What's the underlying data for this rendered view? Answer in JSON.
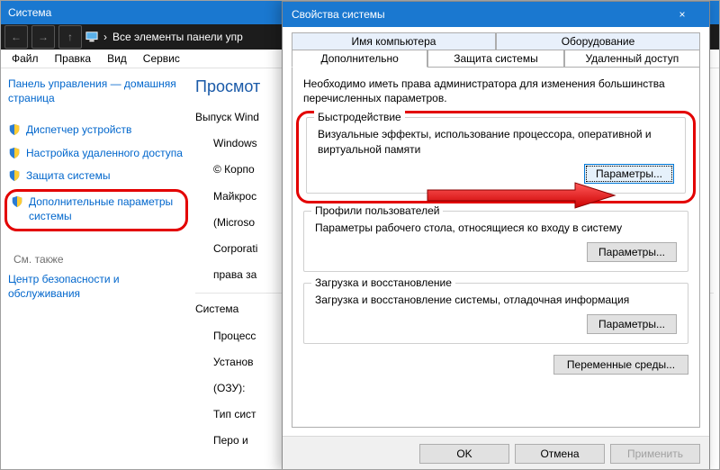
{
  "sysWindow": {
    "title": "Система",
    "breadcrumb": "Все элементы панели упр",
    "menubar": [
      "Файл",
      "Правка",
      "Вид",
      "Сервис"
    ],
    "winbtns": {
      "min": "–",
      "max": "□",
      "close": "×"
    }
  },
  "sidebar": {
    "home": "Панель управления — домашняя страница",
    "items": [
      "Диспетчер устройств",
      "Настройка удаленного доступа",
      "Защита системы",
      "Дополнительные параметры системы"
    ],
    "seeAlsoHeader": "См. также",
    "seeAlso": "Центр безопасности и обслуживания"
  },
  "main": {
    "heading": "Просмот",
    "rows": [
      {
        "k": "Выпуск Wind",
        "v": ""
      },
      {
        "k": "",
        "v": "Windows"
      },
      {
        "k": "",
        "v": "© Корпо"
      },
      {
        "k": "",
        "v": "Майкрос"
      },
      {
        "k": "",
        "v": "(Microso"
      },
      {
        "k": "",
        "v": "Corporati"
      },
      {
        "k": "",
        "v": "права за"
      }
    ],
    "sys": {
      "header": "Система",
      "proc": "Процесс",
      "ram": "Установ",
      "ram2": "(ОЗУ):",
      "type": "Тип сист",
      "pen": "Перо и"
    }
  },
  "dlg": {
    "title": "Свойства системы",
    "tabsTop": [
      "Имя компьютера",
      "Оборудование"
    ],
    "tabsBottom": [
      "Дополнительно",
      "Защита системы",
      "Удаленный доступ"
    ],
    "activeTab": 0,
    "intro": "Необходимо иметь права администратора для изменения большинства перечисленных параметров.",
    "groups": {
      "perf": {
        "legend": "Быстродействие",
        "desc": "Визуальные эффекты, использование процессора, оперативной и виртуальной памяти",
        "button": "Параметры..."
      },
      "profiles": {
        "legend": "Профили пользователей",
        "desc": "Параметры рабочего стола, относящиеся ко входу в систему",
        "button": "Параметры..."
      },
      "startup": {
        "legend": "Загрузка и восстановление",
        "desc": "Загрузка и восстановление системы, отладочная информация",
        "button": "Параметры..."
      }
    },
    "envButton": "Переменные среды...",
    "footer": {
      "ok": "OK",
      "cancel": "Отмена",
      "apply": "Применить"
    }
  }
}
